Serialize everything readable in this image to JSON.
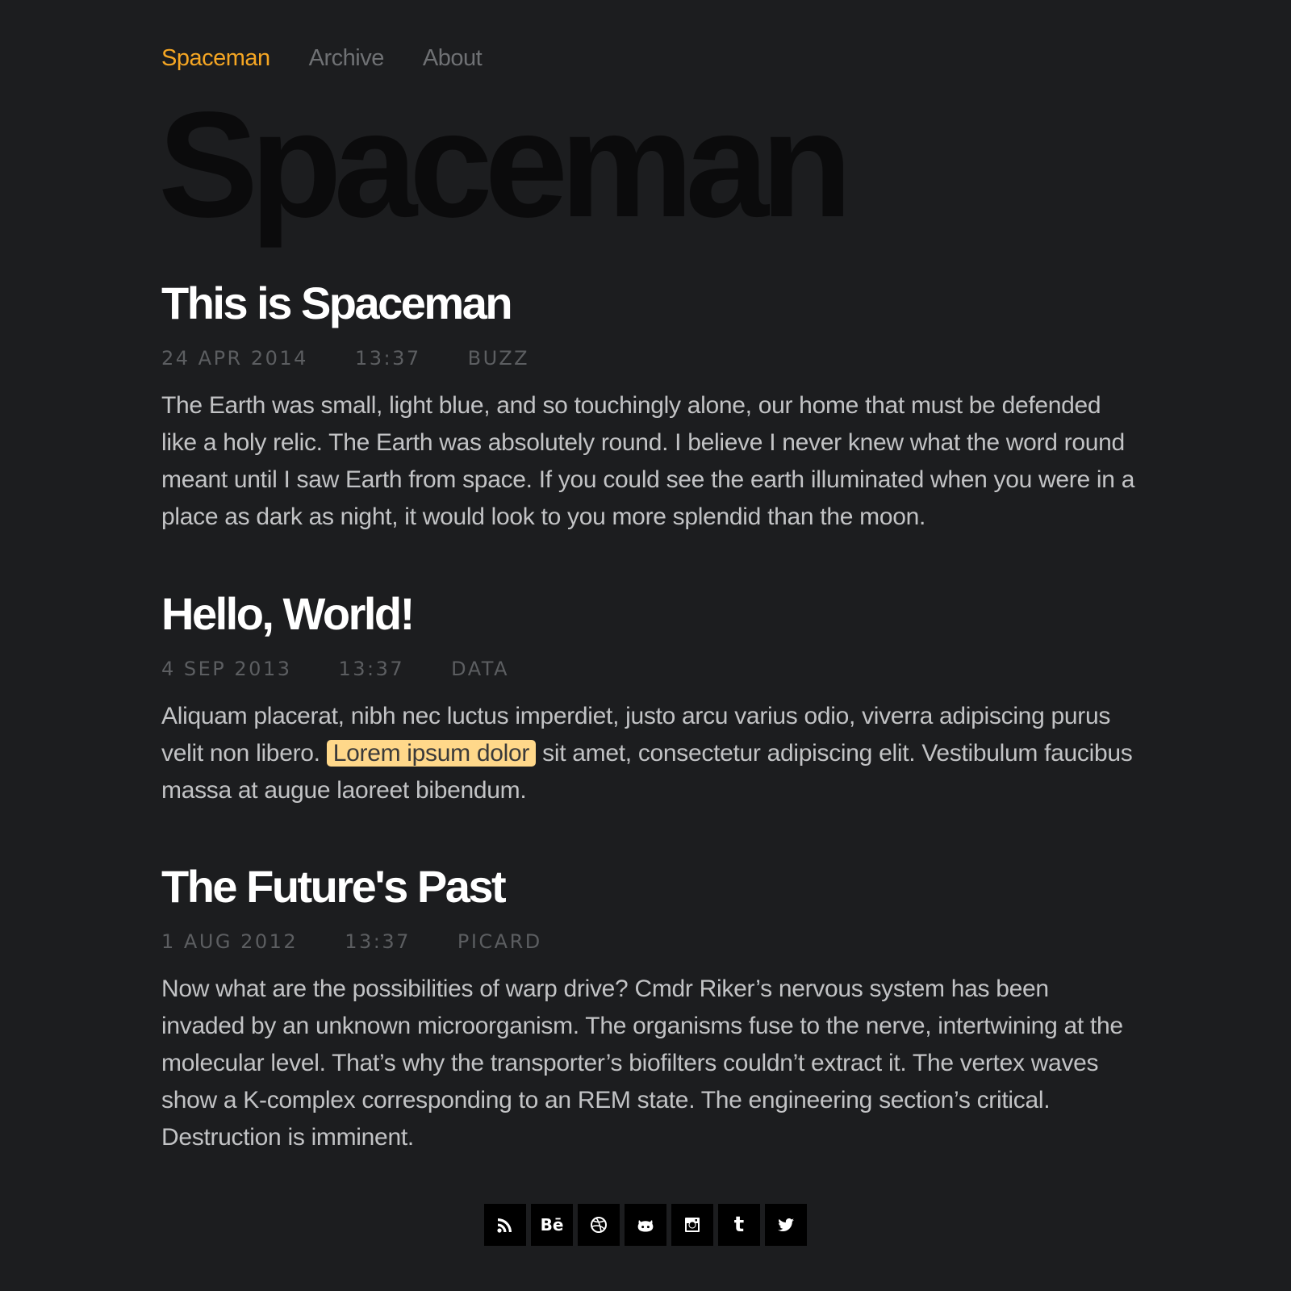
{
  "nav": {
    "items": [
      {
        "label": "Spaceman",
        "active": true
      },
      {
        "label": "Archive",
        "active": false
      },
      {
        "label": "About",
        "active": false
      }
    ]
  },
  "site_title": "Spaceman",
  "posts": [
    {
      "title": "This is Spaceman",
      "date": "24 APR 2014",
      "time": "13:37",
      "tag": "BUZZ",
      "body": "The Earth was small, light blue, and so touchingly alone, our home that must be defended like a holy relic. The Earth was absolutely round. I believe I never knew what the word round meant until I saw Earth from space. If you could see the earth illuminated when you were in a place as dark as night, it would look to you more splendid than the moon."
    },
    {
      "title": "Hello, World!",
      "date": "4 SEP 2013",
      "time": "13:37",
      "tag": "DATA",
      "body_before": "Aliquam placerat, nibh nec luctus imperdiet, justo arcu varius odio, viverra adipiscing purus velit non libero.",
      "highlight": "Lorem ipsum dolor",
      "body_after": "sit amet, consectetur adipiscing elit. Vestibulum faucibus massa at augue laoreet bibendum."
    },
    {
      "title": "The Future's Past",
      "date": "1 AUG 2012",
      "time": "13:37",
      "tag": "PICARD",
      "body": "Now what are the possibilities of warp drive? Cmdr Riker’s nervous system has been invaded by an unknown microorganism. The organisms fuse to the nerve, intertwining at the molecular level. That’s why the transporter’s biofilters couldn’t extract it. The vertex waves show a K-complex corresponding to an REM state. The engineering section’s critical. Destruction is imminent."
    }
  ],
  "social": {
    "icons": [
      "rss-icon",
      "behance-icon",
      "dribbble-icon",
      "github-icon",
      "instagram-icon",
      "tumblr-icon",
      "twitter-icon"
    ],
    "behance_text": "Bē",
    "tumblr_text": "t"
  },
  "colors": {
    "background": "#1c1d1f",
    "accent": "#f5a623",
    "highlight": "#ffd88a"
  }
}
